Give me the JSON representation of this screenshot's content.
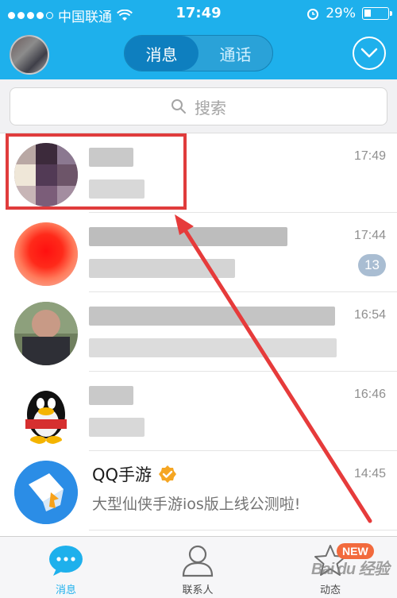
{
  "status_bar": {
    "carrier": "中国联通",
    "time": "17:49",
    "battery": "29%",
    "battery_level": 0.29
  },
  "header": {
    "tabs": [
      {
        "label": "消息",
        "active": true
      },
      {
        "label": "通话",
        "active": false
      }
    ]
  },
  "search": {
    "placeholder": "搜索"
  },
  "conversations": [
    {
      "time": "17:49"
    },
    {
      "time": "17:44",
      "unread": "13"
    },
    {
      "time": "16:54"
    },
    {
      "time": "16:46"
    },
    {
      "title": "QQ手游",
      "message": "大型仙侠手游ios版上线公测啦!",
      "time": "14:45",
      "verified": true
    }
  ],
  "tabbar": {
    "items": [
      {
        "label": "消息",
        "active": true
      },
      {
        "label": "联系人",
        "active": false
      },
      {
        "label": "动态",
        "active": false,
        "badge": "NEW"
      }
    ]
  },
  "watermark": "Bai du 经验",
  "colors": {
    "header_bg": "#1eb0ec",
    "highlight": "#e03c3c",
    "tab_active": "#1eb0ec",
    "tab_inactive": "#8a8a8a",
    "new_badge": "#f26a3d"
  }
}
